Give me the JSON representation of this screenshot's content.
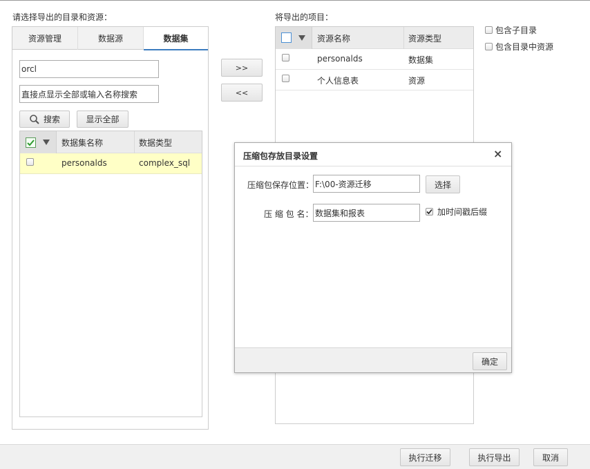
{
  "left": {
    "title": "请选择导出的目录和资源：",
    "tabs": [
      "资源管理",
      "数据源",
      "数据集"
    ],
    "filter_value": "orcl",
    "search_placeholder": "直接点显示全部或输入名称搜索",
    "search_button": "搜索",
    "show_all_button": "显示全部",
    "table": {
      "columns": [
        "数据集名称",
        "数据类型"
      ],
      "rows": [
        {
          "name": "personalds",
          "type": "complex_sql"
        }
      ]
    }
  },
  "transfer": {
    "add": ">>",
    "remove": "<<"
  },
  "right": {
    "title": "将导出的项目：",
    "table": {
      "columns": [
        "资源名称",
        "资源类型"
      ],
      "rows": [
        {
          "name": "personalds",
          "type": "数据集"
        },
        {
          "name": "个人信息表",
          "type": "资源"
        }
      ]
    },
    "options": {
      "include_subdir": "包含子目录",
      "include_resources": "包含目录中资源"
    }
  },
  "dialog": {
    "title": "压缩包存放目录设置",
    "save_location_label": "压缩包保存位置：",
    "save_location_value": "F:\\00-资源迁移",
    "select_button": "选择",
    "package_name_label": "压 缩 包 名：",
    "package_name_value": "数据集和报表",
    "timestamp_label": "加时间戳后缀",
    "timestamp_checked": true,
    "ok_button": "确定",
    "close_symbol": "×"
  },
  "footer": {
    "migrate_button": "执行迁移",
    "export_button": "执行导出",
    "cancel_button": "取消"
  }
}
